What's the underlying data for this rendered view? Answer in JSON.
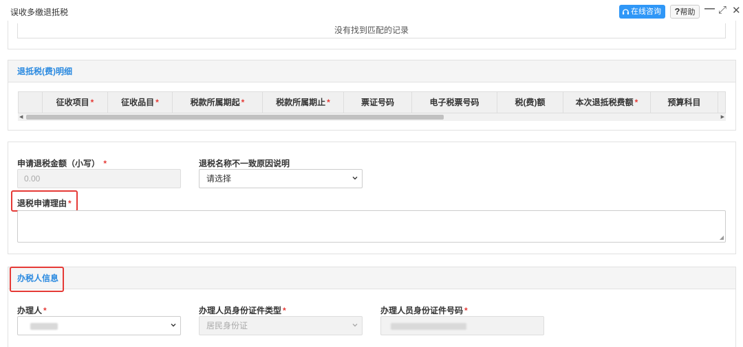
{
  "window": {
    "title": "误收多缴退抵税",
    "online_label": "在线咨询",
    "help_q": "?",
    "help_label": "帮助",
    "minimize": "—",
    "maximize": "⤢",
    "close": "✕"
  },
  "records": {
    "empty_text": "没有找到匹配的记录"
  },
  "detail": {
    "title": "退抵税(费)明细",
    "columns": [
      {
        "label": "征收项目",
        "required": true
      },
      {
        "label": "征收品目",
        "required": true
      },
      {
        "label": "税款所属期起",
        "required": true
      },
      {
        "label": "税款所属期止",
        "required": true
      },
      {
        "label": "票证号码",
        "required": false
      },
      {
        "label": "电子税票号码",
        "required": false
      },
      {
        "label": "税(费)额",
        "required": false
      },
      {
        "label": "本次退抵税费额",
        "required": true
      },
      {
        "label": "预算科目",
        "required": false
      }
    ],
    "req_mark": "*"
  },
  "form": {
    "amount_label": "申请退税金额（小写）",
    "amount_value": "0.00",
    "mismatch_label": "退税名称不一致原因说明",
    "mismatch_value": "请选择",
    "reason_label": "退税申请理由",
    "req_mark": "*"
  },
  "handler": {
    "title": "办税人信息",
    "person_label": "办理人",
    "id_type_label": "办理人员身份证件类型",
    "id_type_value": "居民身份证",
    "id_no_label": "办理人员身份证件号码",
    "req_mark": "*"
  },
  "colors": {
    "accent": "#2b8ae0",
    "required": "#e53935",
    "highlight_box": "#e53935"
  }
}
